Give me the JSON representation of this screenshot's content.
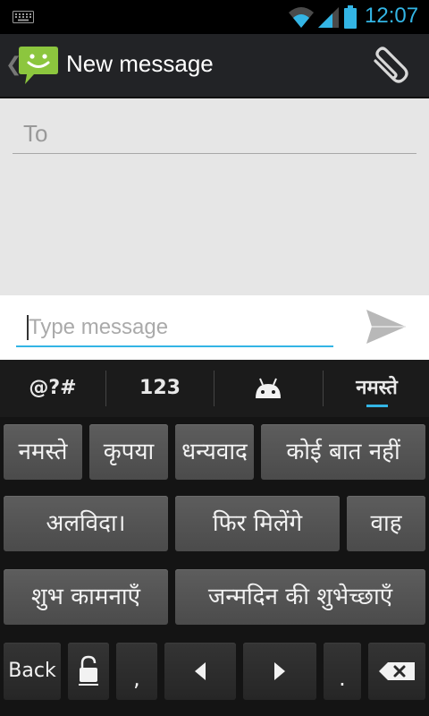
{
  "status_bar": {
    "time": "12:07",
    "icons": [
      "keyboard-icon",
      "wifi-icon",
      "signal-icon",
      "battery-icon"
    ]
  },
  "action_bar": {
    "title": "New message",
    "back_icon": "chevron-left-icon",
    "app_icon": "messaging-app-icon",
    "attach_icon": "paperclip-icon"
  },
  "recipient": {
    "placeholder": "To"
  },
  "compose": {
    "placeholder": "Type message",
    "send_icon": "send-icon"
  },
  "keyboard": {
    "tabs": [
      "@?#",
      "123",
      "",
      "नमस्ते"
    ],
    "tab_icon": "android-icon",
    "phrase_rows": [
      [
        "नमस्ते",
        "कृपया",
        "धन्यवाद",
        "कोई बात नहीं"
      ],
      [
        "अलविदा।",
        "फिर मिलेंगे",
        "वाह"
      ],
      [
        "शुभ कामनाएँ",
        "जन्मदिन की शुभेच्छाएँ"
      ]
    ],
    "bottom_row": {
      "back": "Back",
      "comma": ",",
      "period": ".",
      "icons": [
        "lock-icon",
        "arrow-left-icon",
        "arrow-right-icon",
        "backspace-icon"
      ]
    },
    "colors": {
      "accent": "#33b5e5",
      "key": "#555555"
    }
  }
}
